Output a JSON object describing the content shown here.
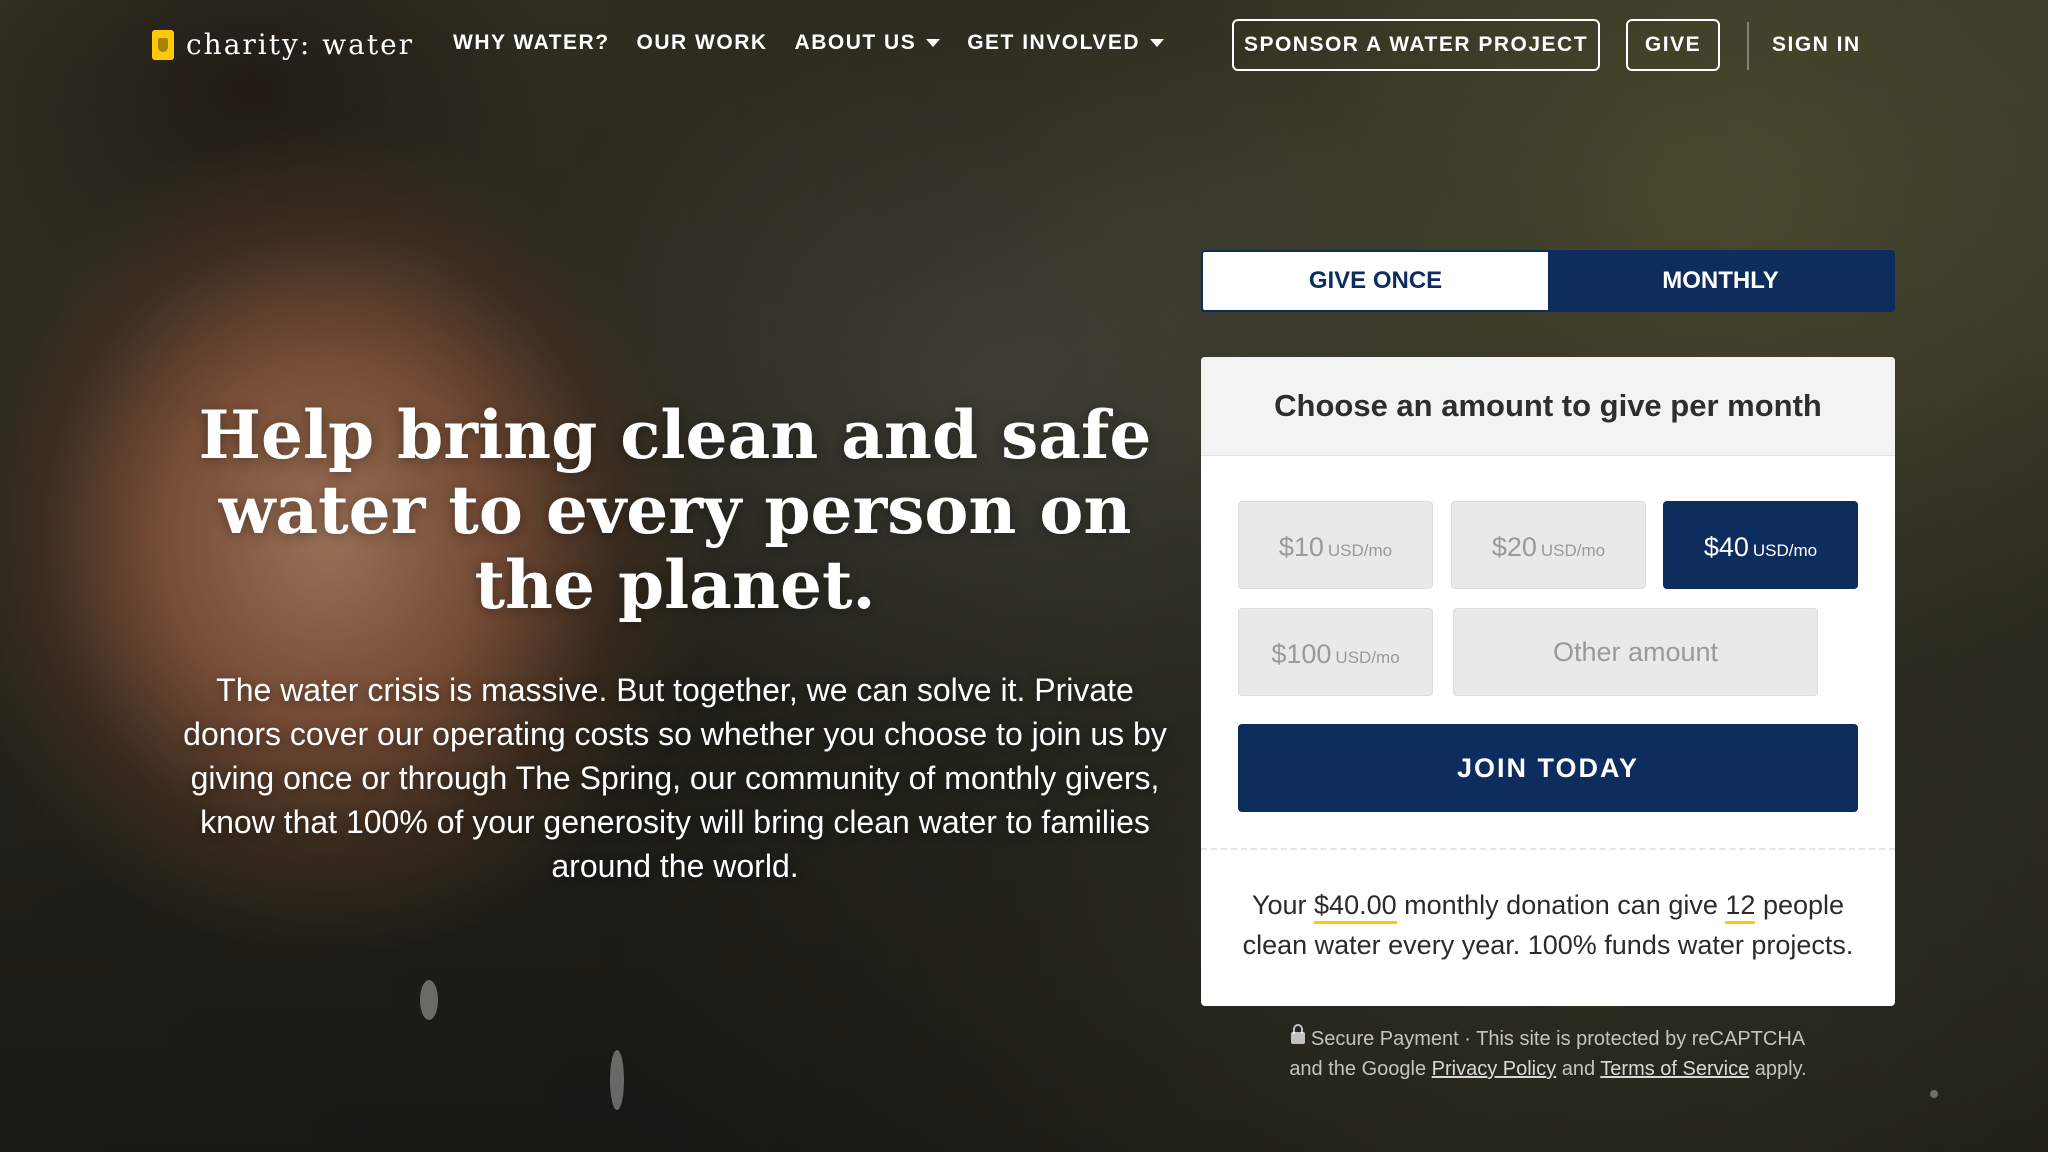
{
  "nav": {
    "logo_text": "charity: water",
    "links": [
      "WHY WATER?",
      "OUR WORK",
      "ABOUT US",
      "GET INVOLVED"
    ],
    "sponsor_label": "SPONSOR A WATER PROJECT",
    "give_label": "GIVE",
    "sign_in_label": "SIGN IN"
  },
  "hero": {
    "headline": "Help bring clean and safe water to every person on the planet.",
    "subtext": "The water crisis is massive. But together, we can solve it. Private donors cover our operating costs so whether you choose to join us by giving once or through The Spring, our community of monthly givers, know that 100% of your generosity will bring clean water to families around the world."
  },
  "donation": {
    "tabs": [
      "GIVE ONCE",
      "MONTHLY"
    ],
    "active_tab": "MONTHLY",
    "heading": "Choose an amount to give per month",
    "amounts": [
      {
        "amount": "$10",
        "unit": "USD/mo"
      },
      {
        "amount": "$20",
        "unit": "USD/mo"
      },
      {
        "amount": "$40",
        "unit": "USD/mo"
      },
      {
        "amount": "$100",
        "unit": "USD/mo"
      }
    ],
    "selected_amount": "$40",
    "other_amount_placeholder": "Other amount",
    "join_label": "JOIN TODAY",
    "impact": {
      "prefix": "Your",
      "amount": "$40.00",
      "middle": "monthly donation can give",
      "people": "12",
      "suffix": "people clean water every year. 100% funds water projects."
    }
  },
  "secure": {
    "line1": "Secure Payment · This site is protected by reCAPTCHA",
    "line2_prefix": "and the Google",
    "privacy_label": "Privacy Policy",
    "and": "and",
    "terms_label": "Terms of Service",
    "apply": "apply."
  },
  "colors": {
    "brand_navy": "#0c2d5e",
    "accent_yellow": "#ffc907"
  }
}
